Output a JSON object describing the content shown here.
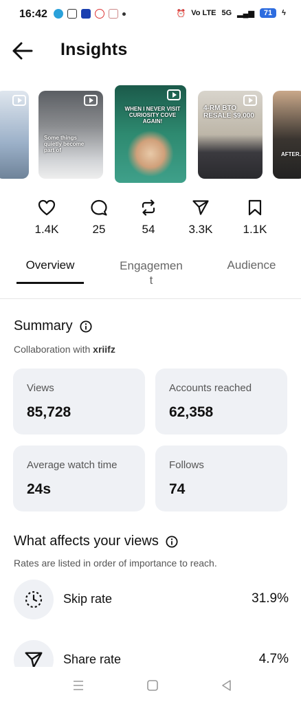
{
  "status_bar": {
    "time": "16:42",
    "net_label": "Vo LTE",
    "signal_label": "5G",
    "battery": "71"
  },
  "header": {
    "title": "Insights"
  },
  "thumbnails": [
    {
      "caption": ""
    },
    {
      "caption": "Some things quietly become part of"
    },
    {
      "caption": "WHEN I NEVER VISIT CURIOSITY COVE AGAIN!"
    },
    {
      "caption": "4-RM BTO RESALE $9,000"
    },
    {
      "caption": "AFTER..."
    }
  ],
  "stats": [
    {
      "icon": "heart-icon",
      "value": "1.4K"
    },
    {
      "icon": "comment-icon",
      "value": "25"
    },
    {
      "icon": "repost-icon",
      "value": "54"
    },
    {
      "icon": "share-icon",
      "value": "3.3K"
    },
    {
      "icon": "bookmark-icon",
      "value": "1.1K"
    }
  ],
  "tabs": [
    {
      "label": "Overview"
    },
    {
      "label": "Engagemen\nt"
    },
    {
      "label": "Audience"
    }
  ],
  "summary": {
    "title": "Summary",
    "collab_prefix": "Collaboration with ",
    "collab_user": "xriifz",
    "cards": [
      {
        "label": "Views",
        "value": "85,728"
      },
      {
        "label": "Accounts reached",
        "value": "62,358"
      },
      {
        "label": "Average watch time",
        "value": "24s"
      },
      {
        "label": "Follows",
        "value": "74"
      }
    ]
  },
  "affects": {
    "title": "What affects your views",
    "subtitle": "Rates are listed in order of importance to reach.",
    "items": [
      {
        "icon": "skip-timer-icon",
        "name": "Skip rate",
        "value": "31.9%"
      },
      {
        "icon": "share-icon",
        "name": "Share rate",
        "value": "4.7%"
      }
    ]
  },
  "colors": {
    "accent": "#2d6cdf",
    "card_bg": "#eff1f5"
  }
}
